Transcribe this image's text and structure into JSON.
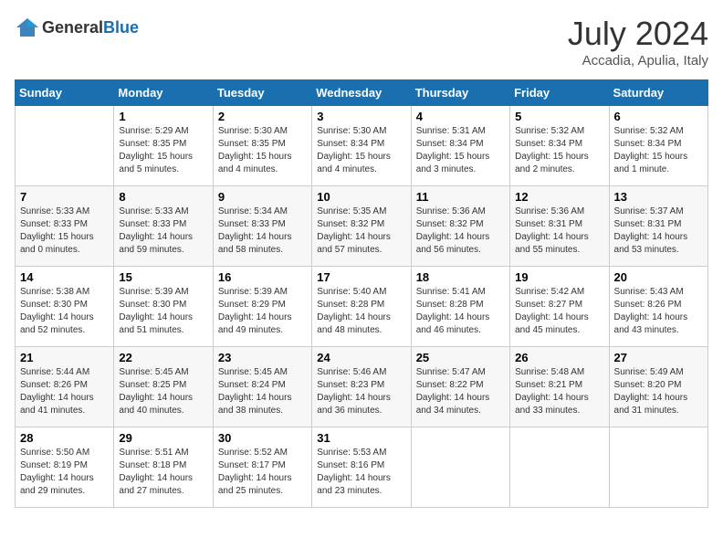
{
  "header": {
    "logo_general": "General",
    "logo_blue": "Blue",
    "month_year": "July 2024",
    "location": "Accadia, Apulia, Italy"
  },
  "days_of_week": [
    "Sunday",
    "Monday",
    "Tuesday",
    "Wednesday",
    "Thursday",
    "Friday",
    "Saturday"
  ],
  "weeks": [
    [
      {
        "day": "",
        "sunrise": "",
        "sunset": "",
        "daylight": ""
      },
      {
        "day": "1",
        "sunrise": "Sunrise: 5:29 AM",
        "sunset": "Sunset: 8:35 PM",
        "daylight": "Daylight: 15 hours and 5 minutes."
      },
      {
        "day": "2",
        "sunrise": "Sunrise: 5:30 AM",
        "sunset": "Sunset: 8:35 PM",
        "daylight": "Daylight: 15 hours and 4 minutes."
      },
      {
        "day": "3",
        "sunrise": "Sunrise: 5:30 AM",
        "sunset": "Sunset: 8:34 PM",
        "daylight": "Daylight: 15 hours and 4 minutes."
      },
      {
        "day": "4",
        "sunrise": "Sunrise: 5:31 AM",
        "sunset": "Sunset: 8:34 PM",
        "daylight": "Daylight: 15 hours and 3 minutes."
      },
      {
        "day": "5",
        "sunrise": "Sunrise: 5:32 AM",
        "sunset": "Sunset: 8:34 PM",
        "daylight": "Daylight: 15 hours and 2 minutes."
      },
      {
        "day": "6",
        "sunrise": "Sunrise: 5:32 AM",
        "sunset": "Sunset: 8:34 PM",
        "daylight": "Daylight: 15 hours and 1 minute."
      }
    ],
    [
      {
        "day": "7",
        "sunrise": "Sunrise: 5:33 AM",
        "sunset": "Sunset: 8:33 PM",
        "daylight": "Daylight: 15 hours and 0 minutes."
      },
      {
        "day": "8",
        "sunrise": "Sunrise: 5:33 AM",
        "sunset": "Sunset: 8:33 PM",
        "daylight": "Daylight: 14 hours and 59 minutes."
      },
      {
        "day": "9",
        "sunrise": "Sunrise: 5:34 AM",
        "sunset": "Sunset: 8:33 PM",
        "daylight": "Daylight: 14 hours and 58 minutes."
      },
      {
        "day": "10",
        "sunrise": "Sunrise: 5:35 AM",
        "sunset": "Sunset: 8:32 PM",
        "daylight": "Daylight: 14 hours and 57 minutes."
      },
      {
        "day": "11",
        "sunrise": "Sunrise: 5:36 AM",
        "sunset": "Sunset: 8:32 PM",
        "daylight": "Daylight: 14 hours and 56 minutes."
      },
      {
        "day": "12",
        "sunrise": "Sunrise: 5:36 AM",
        "sunset": "Sunset: 8:31 PM",
        "daylight": "Daylight: 14 hours and 55 minutes."
      },
      {
        "day": "13",
        "sunrise": "Sunrise: 5:37 AM",
        "sunset": "Sunset: 8:31 PM",
        "daylight": "Daylight: 14 hours and 53 minutes."
      }
    ],
    [
      {
        "day": "14",
        "sunrise": "Sunrise: 5:38 AM",
        "sunset": "Sunset: 8:30 PM",
        "daylight": "Daylight: 14 hours and 52 minutes."
      },
      {
        "day": "15",
        "sunrise": "Sunrise: 5:39 AM",
        "sunset": "Sunset: 8:30 PM",
        "daylight": "Daylight: 14 hours and 51 minutes."
      },
      {
        "day": "16",
        "sunrise": "Sunrise: 5:39 AM",
        "sunset": "Sunset: 8:29 PM",
        "daylight": "Daylight: 14 hours and 49 minutes."
      },
      {
        "day": "17",
        "sunrise": "Sunrise: 5:40 AM",
        "sunset": "Sunset: 8:28 PM",
        "daylight": "Daylight: 14 hours and 48 minutes."
      },
      {
        "day": "18",
        "sunrise": "Sunrise: 5:41 AM",
        "sunset": "Sunset: 8:28 PM",
        "daylight": "Daylight: 14 hours and 46 minutes."
      },
      {
        "day": "19",
        "sunrise": "Sunrise: 5:42 AM",
        "sunset": "Sunset: 8:27 PM",
        "daylight": "Daylight: 14 hours and 45 minutes."
      },
      {
        "day": "20",
        "sunrise": "Sunrise: 5:43 AM",
        "sunset": "Sunset: 8:26 PM",
        "daylight": "Daylight: 14 hours and 43 minutes."
      }
    ],
    [
      {
        "day": "21",
        "sunrise": "Sunrise: 5:44 AM",
        "sunset": "Sunset: 8:26 PM",
        "daylight": "Daylight: 14 hours and 41 minutes."
      },
      {
        "day": "22",
        "sunrise": "Sunrise: 5:45 AM",
        "sunset": "Sunset: 8:25 PM",
        "daylight": "Daylight: 14 hours and 40 minutes."
      },
      {
        "day": "23",
        "sunrise": "Sunrise: 5:45 AM",
        "sunset": "Sunset: 8:24 PM",
        "daylight": "Daylight: 14 hours and 38 minutes."
      },
      {
        "day": "24",
        "sunrise": "Sunrise: 5:46 AM",
        "sunset": "Sunset: 8:23 PM",
        "daylight": "Daylight: 14 hours and 36 minutes."
      },
      {
        "day": "25",
        "sunrise": "Sunrise: 5:47 AM",
        "sunset": "Sunset: 8:22 PM",
        "daylight": "Daylight: 14 hours and 34 minutes."
      },
      {
        "day": "26",
        "sunrise": "Sunrise: 5:48 AM",
        "sunset": "Sunset: 8:21 PM",
        "daylight": "Daylight: 14 hours and 33 minutes."
      },
      {
        "day": "27",
        "sunrise": "Sunrise: 5:49 AM",
        "sunset": "Sunset: 8:20 PM",
        "daylight": "Daylight: 14 hours and 31 minutes."
      }
    ],
    [
      {
        "day": "28",
        "sunrise": "Sunrise: 5:50 AM",
        "sunset": "Sunset: 8:19 PM",
        "daylight": "Daylight: 14 hours and 29 minutes."
      },
      {
        "day": "29",
        "sunrise": "Sunrise: 5:51 AM",
        "sunset": "Sunset: 8:18 PM",
        "daylight": "Daylight: 14 hours and 27 minutes."
      },
      {
        "day": "30",
        "sunrise": "Sunrise: 5:52 AM",
        "sunset": "Sunset: 8:17 PM",
        "daylight": "Daylight: 14 hours and 25 minutes."
      },
      {
        "day": "31",
        "sunrise": "Sunrise: 5:53 AM",
        "sunset": "Sunset: 8:16 PM",
        "daylight": "Daylight: 14 hours and 23 minutes."
      },
      {
        "day": "",
        "sunrise": "",
        "sunset": "",
        "daylight": ""
      },
      {
        "day": "",
        "sunrise": "",
        "sunset": "",
        "daylight": ""
      },
      {
        "day": "",
        "sunrise": "",
        "sunset": "",
        "daylight": ""
      }
    ]
  ]
}
